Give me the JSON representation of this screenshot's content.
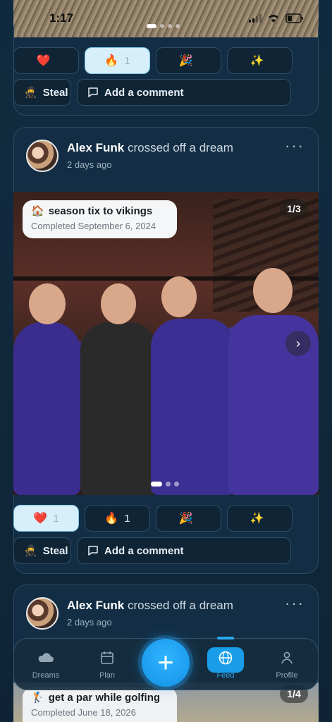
{
  "status_bar": {
    "time": "1:17"
  },
  "top_reactions": [
    {
      "emoji": "❤️",
      "count": ""
    },
    {
      "emoji": "🔥",
      "count": "1"
    },
    {
      "emoji": "🎉",
      "count": ""
    },
    {
      "emoji": "✨",
      "count": ""
    }
  ],
  "top_actions": {
    "steal_label": "Steal",
    "comment_label": "Add a comment"
  },
  "post1": {
    "author": "Alex Funk",
    "action_text": "crossed off a dream",
    "time": "2 days ago",
    "more_icon": "more-horizontal-icon",
    "dream_tag": {
      "emoji": "🏠",
      "title": "season tix to vikings",
      "completed": "Completed September 6, 2024"
    },
    "image_counter": "1/3",
    "reactions": [
      {
        "emoji": "❤️",
        "count": "1"
      },
      {
        "emoji": "🔥",
        "count": "1"
      },
      {
        "emoji": "🎉",
        "count": ""
      },
      {
        "emoji": "✨",
        "count": ""
      }
    ],
    "steal_label": "Steal",
    "comment_label": "Add a comment"
  },
  "post2": {
    "author": "Alex Funk",
    "action_text": "crossed off a dream",
    "time": "2 days ago",
    "dream_tag": {
      "emoji": "🏌️",
      "title": "get a par while golfing",
      "completed": "Completed June 18, 2026"
    },
    "image_counter": "1/4"
  },
  "nav": {
    "items": [
      {
        "label": "Dreams",
        "icon": "cloud-icon"
      },
      {
        "label": "Plan",
        "icon": "calendar-icon"
      },
      {
        "label": "Feed",
        "icon": "globe-icon"
      },
      {
        "label": "Profile",
        "icon": "person-icon"
      }
    ],
    "active": "Feed",
    "fab_icon": "plus-icon"
  },
  "colors": {
    "accent": "#1a9de8",
    "background": "#11293d",
    "card": "#132e44"
  }
}
